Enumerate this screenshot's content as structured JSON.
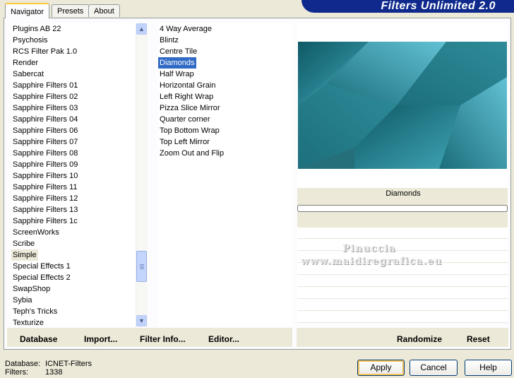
{
  "tabs": [
    "Navigator",
    "Presets",
    "About"
  ],
  "banner": "Filters Unlimited 2.0",
  "categories": [
    "Plugins AB 22",
    "Psychosis",
    "RCS Filter Pak 1.0",
    "Render",
    "Sabercat",
    "Sapphire Filters 01",
    "Sapphire Filters 02",
    "Sapphire Filters 03",
    "Sapphire Filters 04",
    "Sapphire Filters 06",
    "Sapphire Filters 07",
    "Sapphire Filters 08",
    "Sapphire Filters 09",
    "Sapphire Filters 10",
    "Sapphire Filters 11",
    "Sapphire Filters 12",
    "Sapphire Filters 13",
    "Sapphire Filters 1c",
    "ScreenWorks",
    "Scribe",
    "Simple",
    "Special Effects 1",
    "Special Effects 2",
    "SwapShop",
    "Sybia",
    "Teph's Tricks",
    "Texturize"
  ],
  "selected_category": "Simple",
  "filters": [
    "4 Way Average",
    "Blintz",
    "Centre Tile",
    "Diamonds",
    "Half Wrap",
    "Horizontal Grain",
    "Left Right Wrap",
    "Pizza Slice Mirror",
    "Quarter corner",
    "Top Bottom Wrap",
    "Top Left Mirror",
    "Zoom Out and Flip"
  ],
  "selected_filter": "Diamonds",
  "preview": {
    "filter_name": "Diamonds",
    "progress": 0,
    "base_color": "#2e8b99"
  },
  "toolbar": {
    "database_label": "Database",
    "import_label": "Import...",
    "filter_info_label": "Filter Info...",
    "editor_label": "Editor...",
    "randomize_label": "Randomize",
    "reset_label": "Reset"
  },
  "watermark": {
    "line1": "Pinuccia",
    "line2": "www.maidiregrafica.eu"
  },
  "status": {
    "database_label": "Database:",
    "database_value": "ICNET-Filters",
    "filters_label": "Filters:",
    "filters_value": "1338"
  },
  "buttons": {
    "apply": "Apply",
    "cancel": "Cancel",
    "help": "Help"
  }
}
